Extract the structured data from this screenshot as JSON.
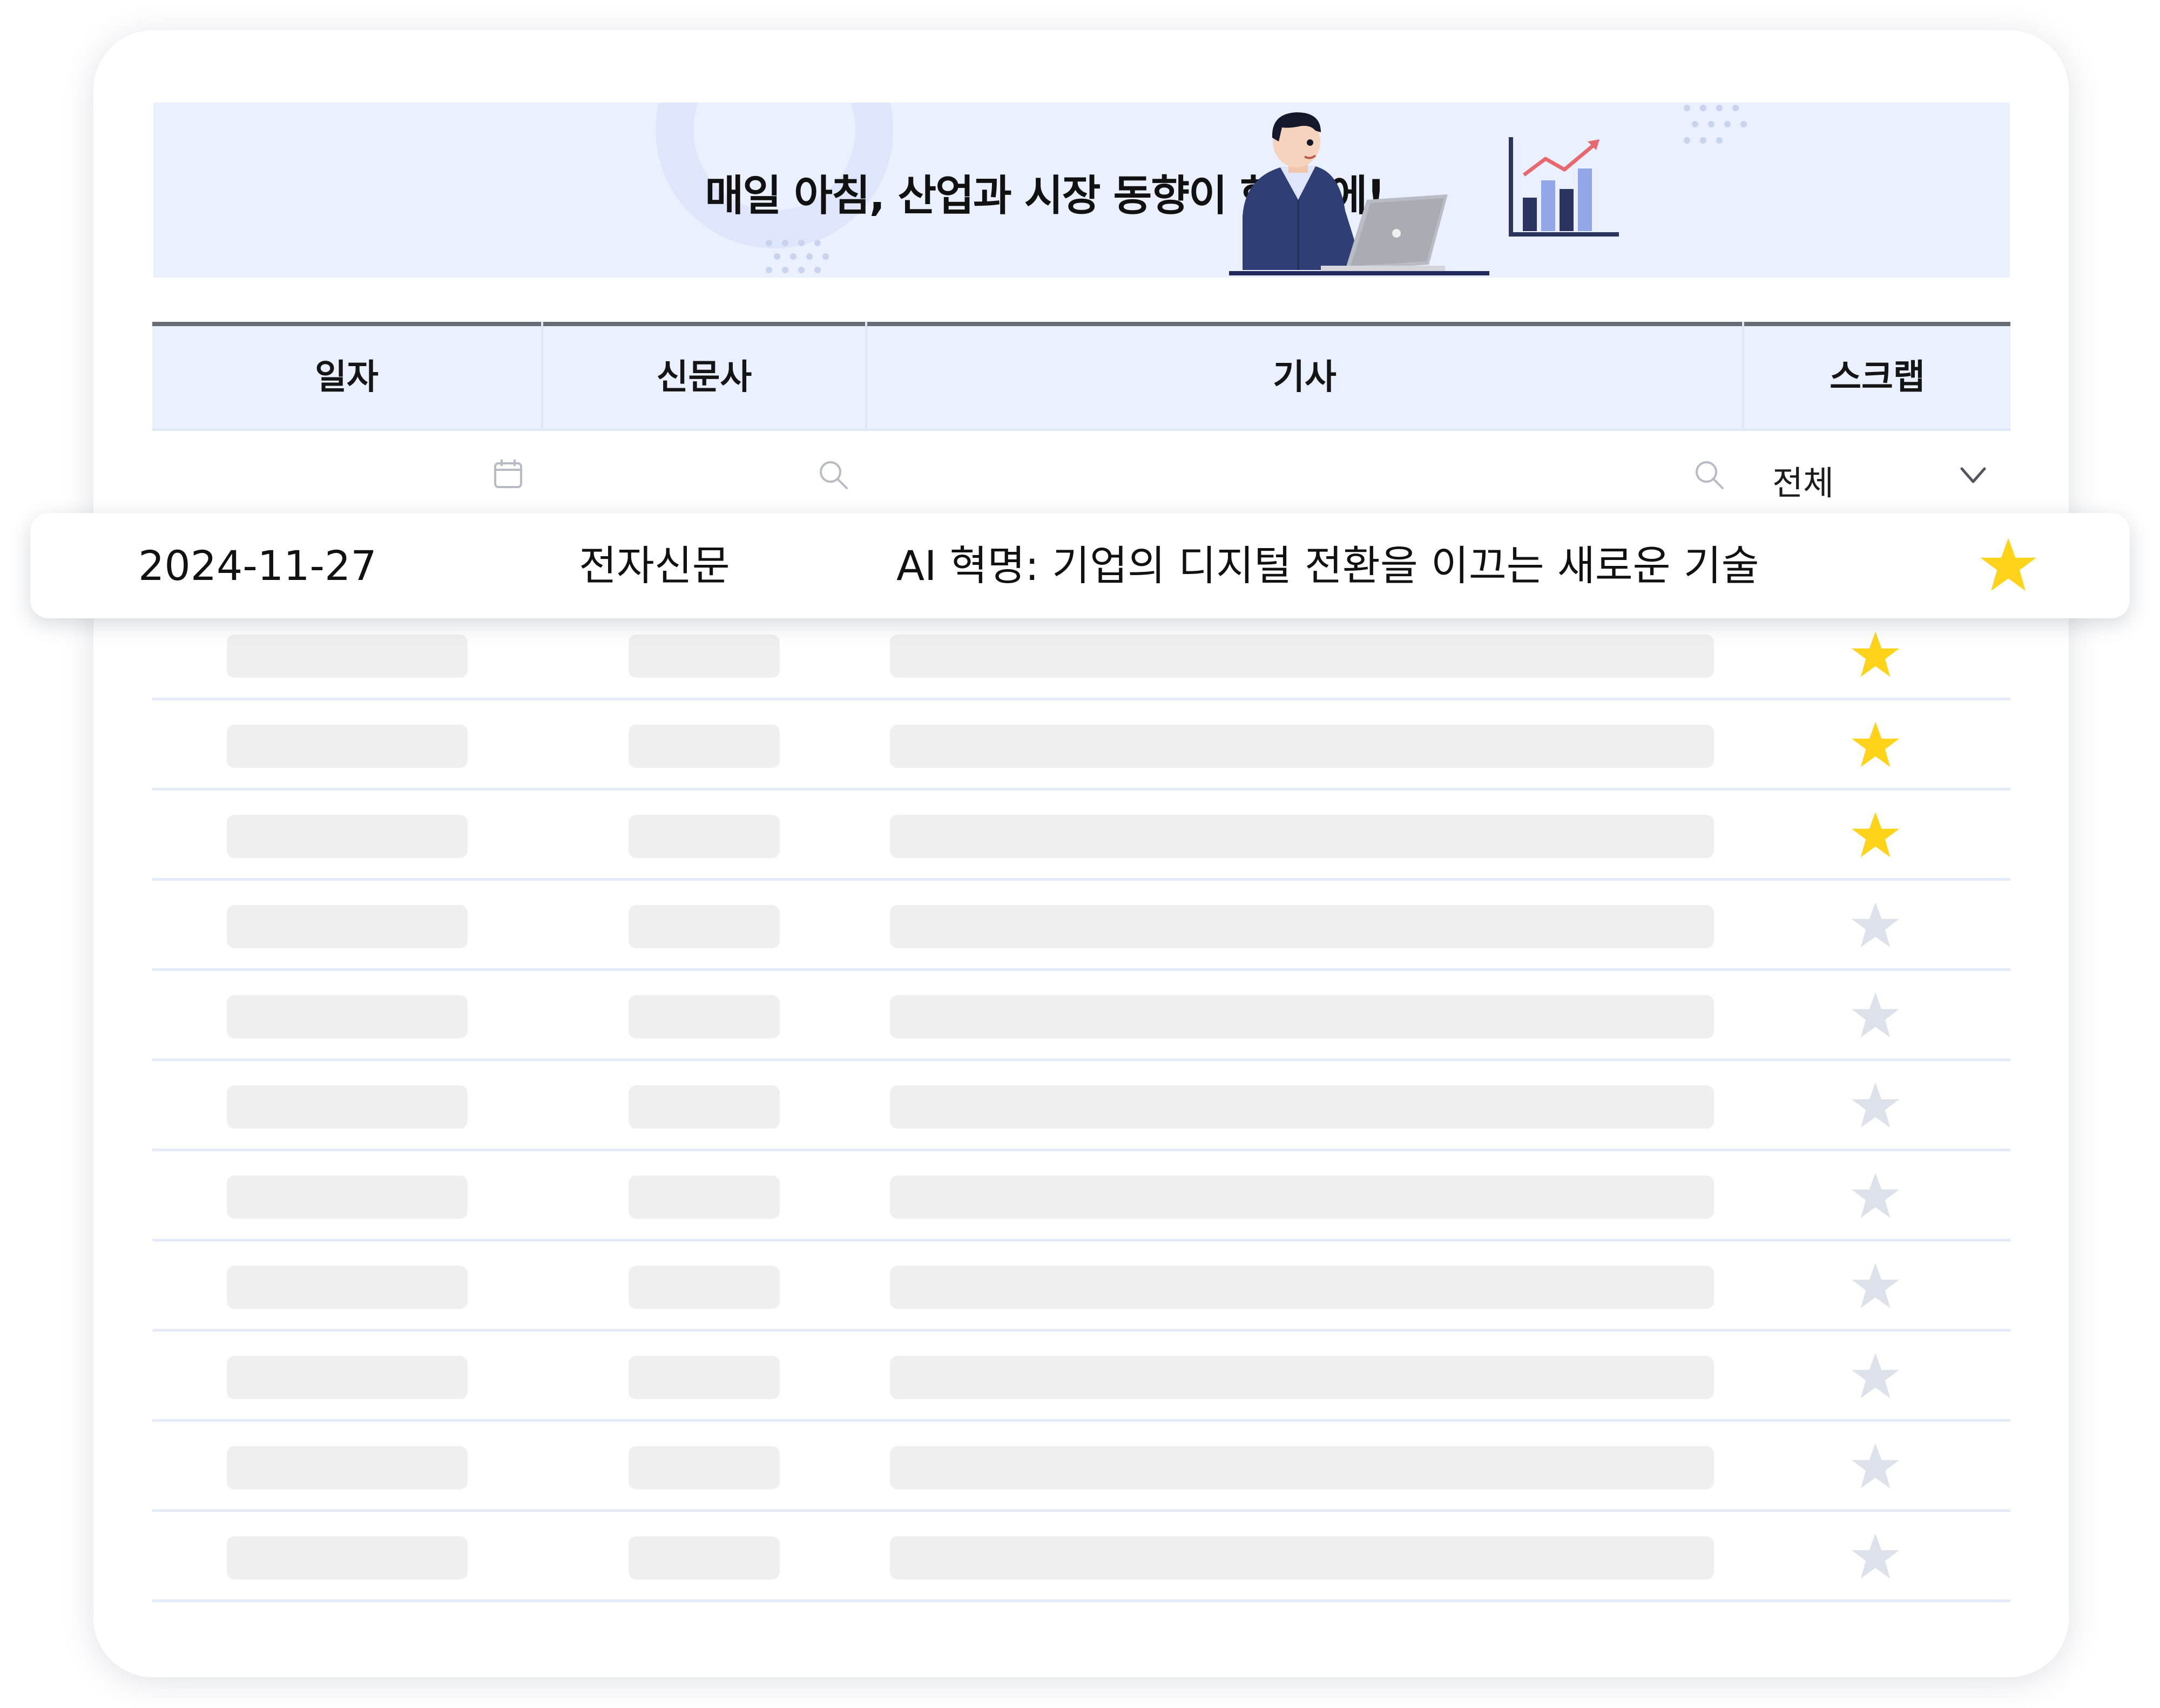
{
  "banner": {
    "headline": "매일 아침, 산업과 시장 동향이 한 눈에!",
    "illustration": "person-with-laptop",
    "chart_icon": "rising-bar-chart-icon"
  },
  "table": {
    "columns": [
      {
        "key": "date",
        "label": "일자",
        "filter": "calendar-icon"
      },
      {
        "key": "publisher",
        "label": "신문사",
        "filter": "search-icon"
      },
      {
        "key": "article",
        "label": "기사",
        "filter": "search-icon"
      },
      {
        "key": "scrap",
        "label": "스크랩",
        "filter": "dropdown"
      }
    ],
    "scrap_filter": {
      "selected": "전체",
      "icon": "chevron-down-icon"
    },
    "highlighted_row": {
      "date": "2024-11-27",
      "publisher": "전자신문",
      "title": "AI 혁명: 기업의 디지털 전환을 이끄는 새로운 기술",
      "scrapped": true
    },
    "rows": [
      {
        "scrapped": true
      },
      {
        "scrapped": true
      },
      {
        "scrapped": true
      },
      {
        "scrapped": false
      },
      {
        "scrapped": false
      },
      {
        "scrapped": false
      },
      {
        "scrapped": false
      },
      {
        "scrapped": false
      },
      {
        "scrapped": false
      },
      {
        "scrapped": false
      },
      {
        "scrapped": false
      }
    ]
  },
  "colors": {
    "star_active": "#FFD31A",
    "star_inactive": "#DDE2EA",
    "header_bg": "#EAF0FE",
    "skeleton": "#EFEFEF"
  }
}
